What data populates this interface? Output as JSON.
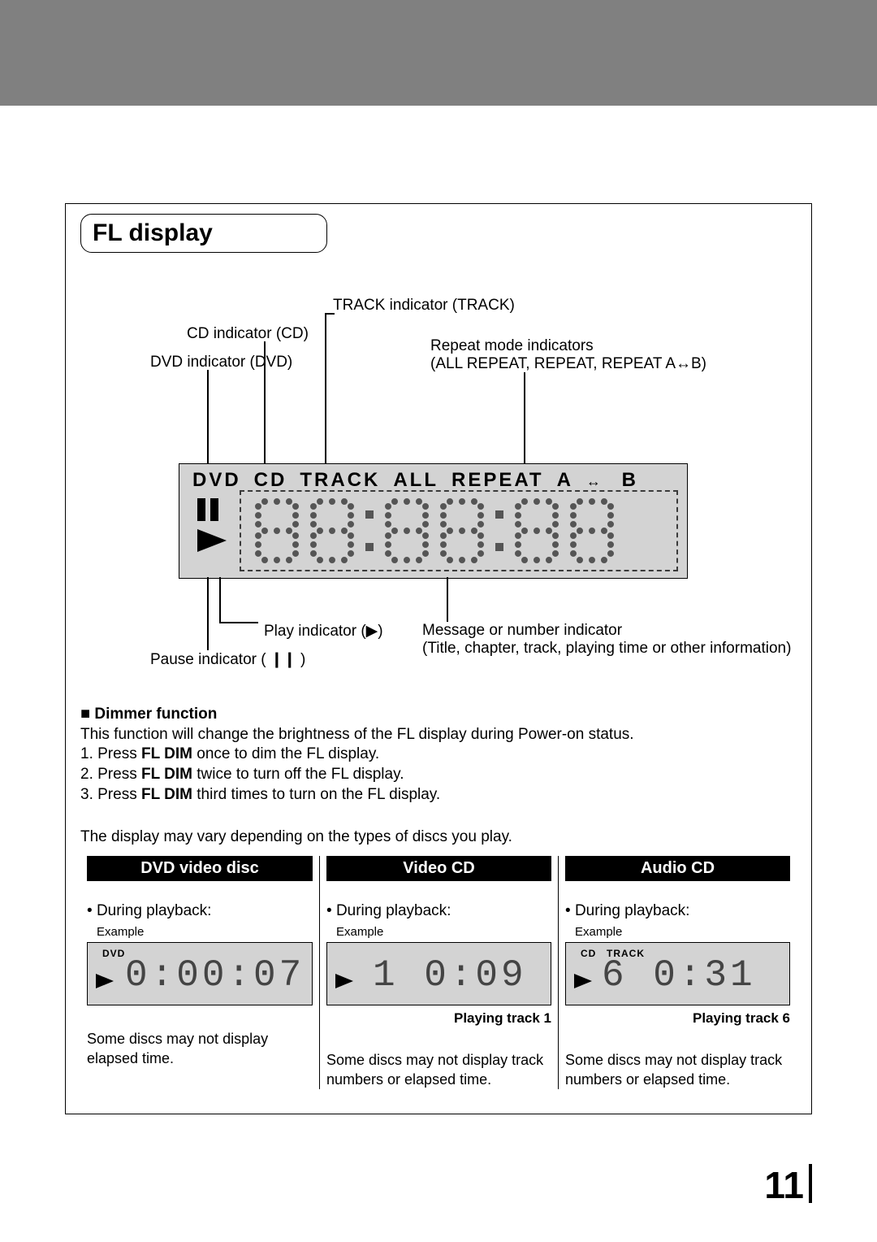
{
  "section_title": "FL display",
  "labels": {
    "track_indicator": "TRACK indicator (TRACK)",
    "cd_indicator": "CD indicator (CD)",
    "dvd_indicator": "DVD indicator (DVD)",
    "repeat_indicators_title": "Repeat mode indicators",
    "repeat_indicators_detail": "(ALL REPEAT, REPEAT, REPEAT A↔B)",
    "play_indicator": "Play indicator (▶)",
    "pause_indicator": "Pause indicator ( ❙❙ )",
    "msg_indicator_title": "Message or number indicator",
    "msg_indicator_detail": "(Title, chapter, track, playing time or other information)"
  },
  "panel": {
    "dvd": "DVD",
    "cd": "CD",
    "track": "TRACK",
    "all": "ALL",
    "repeat": "REPEAT",
    "a": "A",
    "b": "B"
  },
  "dimmer": {
    "heading": "Dimmer function",
    "intro": "This function will change the brightness of the FL display during Power-on status.",
    "step1_pre": "1. Press ",
    "step_bold": "FL DIM",
    "step1_post": " once to dim the FL display.",
    "step2_pre": "2. Press ",
    "step2_post": " twice to turn off the FL display.",
    "step3_pre": "3. Press ",
    "step3_post": " third times to turn on the FL display."
  },
  "vary_note": "The display may vary depending on the types of discs you play.",
  "columns": [
    {
      "title": "DVD video disc",
      "during": "During playback:",
      "example_label": "Example",
      "tag1": "DVD",
      "seg_text": "0:00:07",
      "subcaption": "",
      "note": "Some discs may not display elapsed time."
    },
    {
      "title": "Video CD",
      "during": "During playback:",
      "example_label": "Example",
      "seg_text": "1   0:09",
      "subcaption": "Playing track 1",
      "note": "Some discs may not display track numbers or elapsed time."
    },
    {
      "title": "Audio CD",
      "during": "During playback:",
      "example_label": "Example",
      "tag1": "CD",
      "tag2": "TRACK",
      "seg_text": "6   0:31",
      "subcaption": "Playing track 6",
      "note": "Some discs may not display track numbers or elapsed time."
    }
  ],
  "page_number": "11"
}
